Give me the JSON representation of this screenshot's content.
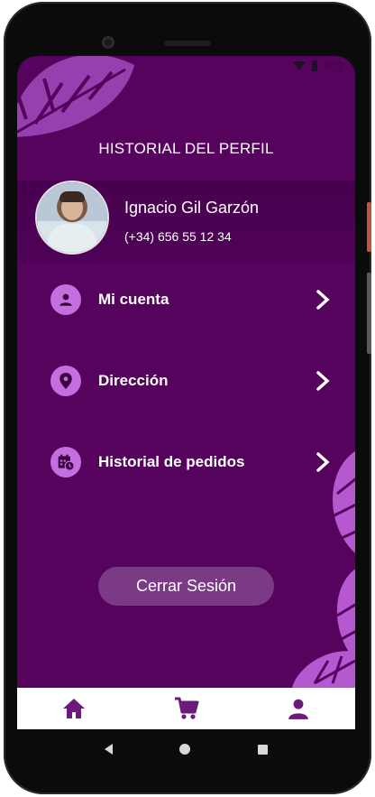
{
  "status_bar": {
    "time": "3:17"
  },
  "header": {
    "title": "HISTORIAL DEL PERFIL"
  },
  "profile": {
    "name": "Ignacio Gil Garzón",
    "phone": "(+34) 656 55 12 34"
  },
  "menu": [
    {
      "label": "Mi cuenta",
      "icon": "person-icon"
    },
    {
      "label": "Dirección",
      "icon": "location-pin-icon"
    },
    {
      "label": "Historial de pedidos",
      "icon": "calendar-clock-icon"
    }
  ],
  "logout": {
    "label": "Cerrar Sesión"
  },
  "bottom_nav": {
    "items": [
      "home-icon",
      "cart-icon",
      "profile-icon"
    ],
    "active_color": "#6a1b7a"
  },
  "colors": {
    "background": "#55035d",
    "accent": "#c46ee0",
    "leaf": "#b659d1"
  }
}
